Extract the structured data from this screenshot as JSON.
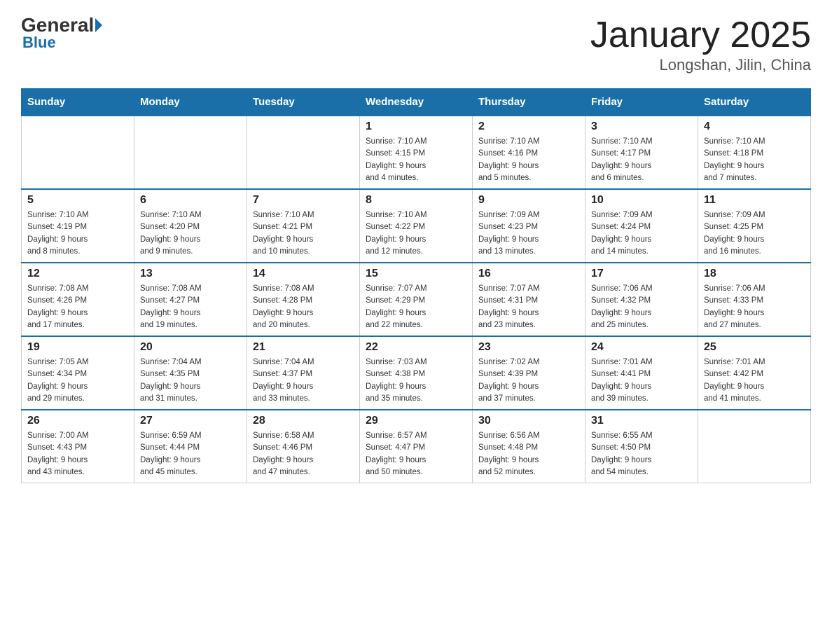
{
  "header": {
    "logo_general": "General",
    "logo_blue": "Blue",
    "month_title": "January 2025",
    "location": "Longshan, Jilin, China"
  },
  "weekdays": [
    "Sunday",
    "Monday",
    "Tuesday",
    "Wednesday",
    "Thursday",
    "Friday",
    "Saturday"
  ],
  "weeks": [
    [
      {
        "day": "",
        "info": ""
      },
      {
        "day": "",
        "info": ""
      },
      {
        "day": "",
        "info": ""
      },
      {
        "day": "1",
        "info": "Sunrise: 7:10 AM\nSunset: 4:15 PM\nDaylight: 9 hours\nand 4 minutes."
      },
      {
        "day": "2",
        "info": "Sunrise: 7:10 AM\nSunset: 4:16 PM\nDaylight: 9 hours\nand 5 minutes."
      },
      {
        "day": "3",
        "info": "Sunrise: 7:10 AM\nSunset: 4:17 PM\nDaylight: 9 hours\nand 6 minutes."
      },
      {
        "day": "4",
        "info": "Sunrise: 7:10 AM\nSunset: 4:18 PM\nDaylight: 9 hours\nand 7 minutes."
      }
    ],
    [
      {
        "day": "5",
        "info": "Sunrise: 7:10 AM\nSunset: 4:19 PM\nDaylight: 9 hours\nand 8 minutes."
      },
      {
        "day": "6",
        "info": "Sunrise: 7:10 AM\nSunset: 4:20 PM\nDaylight: 9 hours\nand 9 minutes."
      },
      {
        "day": "7",
        "info": "Sunrise: 7:10 AM\nSunset: 4:21 PM\nDaylight: 9 hours\nand 10 minutes."
      },
      {
        "day": "8",
        "info": "Sunrise: 7:10 AM\nSunset: 4:22 PM\nDaylight: 9 hours\nand 12 minutes."
      },
      {
        "day": "9",
        "info": "Sunrise: 7:09 AM\nSunset: 4:23 PM\nDaylight: 9 hours\nand 13 minutes."
      },
      {
        "day": "10",
        "info": "Sunrise: 7:09 AM\nSunset: 4:24 PM\nDaylight: 9 hours\nand 14 minutes."
      },
      {
        "day": "11",
        "info": "Sunrise: 7:09 AM\nSunset: 4:25 PM\nDaylight: 9 hours\nand 16 minutes."
      }
    ],
    [
      {
        "day": "12",
        "info": "Sunrise: 7:08 AM\nSunset: 4:26 PM\nDaylight: 9 hours\nand 17 minutes."
      },
      {
        "day": "13",
        "info": "Sunrise: 7:08 AM\nSunset: 4:27 PM\nDaylight: 9 hours\nand 19 minutes."
      },
      {
        "day": "14",
        "info": "Sunrise: 7:08 AM\nSunset: 4:28 PM\nDaylight: 9 hours\nand 20 minutes."
      },
      {
        "day": "15",
        "info": "Sunrise: 7:07 AM\nSunset: 4:29 PM\nDaylight: 9 hours\nand 22 minutes."
      },
      {
        "day": "16",
        "info": "Sunrise: 7:07 AM\nSunset: 4:31 PM\nDaylight: 9 hours\nand 23 minutes."
      },
      {
        "day": "17",
        "info": "Sunrise: 7:06 AM\nSunset: 4:32 PM\nDaylight: 9 hours\nand 25 minutes."
      },
      {
        "day": "18",
        "info": "Sunrise: 7:06 AM\nSunset: 4:33 PM\nDaylight: 9 hours\nand 27 minutes."
      }
    ],
    [
      {
        "day": "19",
        "info": "Sunrise: 7:05 AM\nSunset: 4:34 PM\nDaylight: 9 hours\nand 29 minutes."
      },
      {
        "day": "20",
        "info": "Sunrise: 7:04 AM\nSunset: 4:35 PM\nDaylight: 9 hours\nand 31 minutes."
      },
      {
        "day": "21",
        "info": "Sunrise: 7:04 AM\nSunset: 4:37 PM\nDaylight: 9 hours\nand 33 minutes."
      },
      {
        "day": "22",
        "info": "Sunrise: 7:03 AM\nSunset: 4:38 PM\nDaylight: 9 hours\nand 35 minutes."
      },
      {
        "day": "23",
        "info": "Sunrise: 7:02 AM\nSunset: 4:39 PM\nDaylight: 9 hours\nand 37 minutes."
      },
      {
        "day": "24",
        "info": "Sunrise: 7:01 AM\nSunset: 4:41 PM\nDaylight: 9 hours\nand 39 minutes."
      },
      {
        "day": "25",
        "info": "Sunrise: 7:01 AM\nSunset: 4:42 PM\nDaylight: 9 hours\nand 41 minutes."
      }
    ],
    [
      {
        "day": "26",
        "info": "Sunrise: 7:00 AM\nSunset: 4:43 PM\nDaylight: 9 hours\nand 43 minutes."
      },
      {
        "day": "27",
        "info": "Sunrise: 6:59 AM\nSunset: 4:44 PM\nDaylight: 9 hours\nand 45 minutes."
      },
      {
        "day": "28",
        "info": "Sunrise: 6:58 AM\nSunset: 4:46 PM\nDaylight: 9 hours\nand 47 minutes."
      },
      {
        "day": "29",
        "info": "Sunrise: 6:57 AM\nSunset: 4:47 PM\nDaylight: 9 hours\nand 50 minutes."
      },
      {
        "day": "30",
        "info": "Sunrise: 6:56 AM\nSunset: 4:48 PM\nDaylight: 9 hours\nand 52 minutes."
      },
      {
        "day": "31",
        "info": "Sunrise: 6:55 AM\nSunset: 4:50 PM\nDaylight: 9 hours\nand 54 minutes."
      },
      {
        "day": "",
        "info": ""
      }
    ]
  ]
}
